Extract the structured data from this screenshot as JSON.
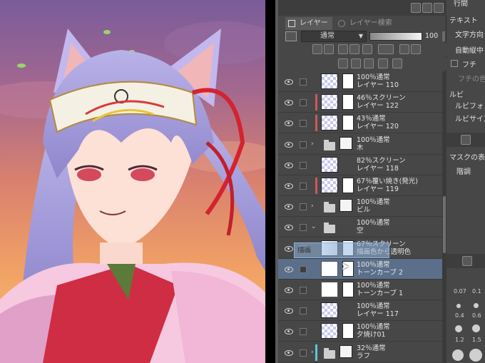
{
  "layer_panel": {
    "tabs": [
      "レイヤー",
      "レイヤー検索"
    ],
    "blend_mode": "通常",
    "opacity": "100",
    "layers": [
      {
        "opacity_mode": "100％通常",
        "name": "レイヤー 110",
        "kind": "layer-mask",
        "color": ""
      },
      {
        "opacity_mode": "46％スクリーン",
        "name": "レイヤー 122",
        "kind": "layer-mask",
        "color": "#c85a5a"
      },
      {
        "opacity_mode": "43％通常",
        "name": "レイヤー 120",
        "kind": "layer-mask",
        "color": "#c85a5a"
      },
      {
        "opacity_mode": "100％通常",
        "name": "木",
        "kind": "folder",
        "color": ""
      },
      {
        "opacity_mode": "82％スクリーン",
        "name": "レイヤー 118",
        "kind": "layer",
        "color": ""
      },
      {
        "opacity_mode": "67％覆い焼き(発光)",
        "name": "レイヤー 119",
        "kind": "layer-mask",
        "color": "#c85a5a"
      },
      {
        "opacity_mode": "100％通常",
        "name": "ビル",
        "kind": "folder",
        "color": ""
      },
      {
        "opacity_mode": "100％通常",
        "name": "空",
        "kind": "folder-open",
        "color": ""
      },
      {
        "opacity_mode": "67％スクリーン",
        "name": "描画色から透明色",
        "kind": "gradient",
        "color": ""
      },
      {
        "opacity_mode": "100％通常",
        "name": "トーンカーブ 2",
        "kind": "tonecurve",
        "color": "",
        "selected": true
      },
      {
        "opacity_mode": "100％通常",
        "name": "トーンカーブ 1",
        "kind": "tonecurve",
        "color": ""
      },
      {
        "opacity_mode": "100％通常",
        "name": "レイヤー 117",
        "kind": "layer",
        "color": ""
      },
      {
        "opacity_mode": "100％通常",
        "name": "夕焼け01",
        "kind": "layer-mask",
        "color": ""
      },
      {
        "opacity_mode": "32％通常",
        "name": "ラフ",
        "kind": "folder",
        "color": "#5ac8d8"
      }
    ],
    "drag_hint": "描画"
  },
  "props_panel": {
    "labels": [
      "行間",
      "テキスト",
      "文字方向",
      "自動縦中",
      "フチ",
      "フチの色",
      "ルビ",
      "ルビフォン",
      "ルビサイズ",
      "マスクの表示",
      "階調"
    ],
    "brush_sizes": [
      "0.07",
      "0.1",
      "0.4",
      "0.6",
      "1.2",
      "1.5"
    ]
  },
  "colors": {
    "panel": "#474747",
    "selected_row": "#5b6f8a",
    "accent_red": "#c85a5a",
    "accent_cyan": "#5ac8d8"
  }
}
